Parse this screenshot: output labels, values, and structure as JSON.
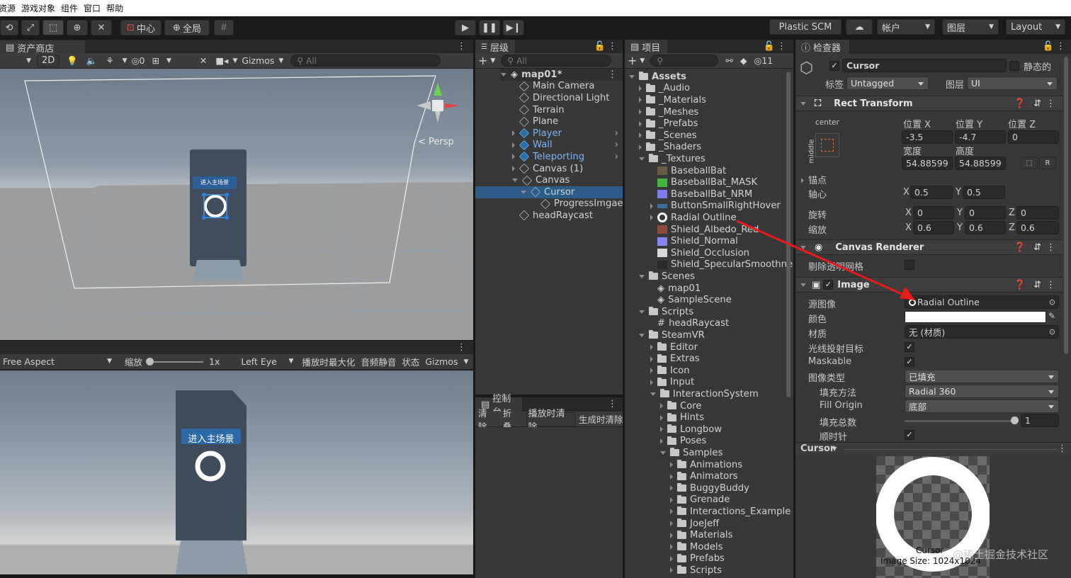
{
  "menubar": {
    "items": [
      "资源",
      "游戏对象",
      "组件",
      "窗口",
      "帮助"
    ]
  },
  "toolbar": {
    "pivot": "中心",
    "space": "全局",
    "plastic": "Plastic SCM",
    "account": "帐户",
    "layers": "图层",
    "layout": "Layout"
  },
  "scene": {
    "tab": "资产商店",
    "mode2d": "2D",
    "hidden_count": "0",
    "gizmos": "Gizmos",
    "search_placeholder": "All",
    "persp": "< Persp",
    "button_text": "进入主场景"
  },
  "game": {
    "aspect": "Free Aspect",
    "scale_label": "缩放",
    "scale_value": "1x",
    "eye": "Left Eye",
    "maximize": "播放时最大化",
    "mute": "音频静音",
    "stats": "状态",
    "gizmos": "Gizmos",
    "button_text": "进入主场景"
  },
  "hierarchy": {
    "tab": "层级",
    "search_placeholder": "All",
    "scene": "map01*",
    "items": [
      {
        "label": "Main Camera",
        "blue": false
      },
      {
        "label": "Directional Light",
        "blue": false
      },
      {
        "label": "Terrain",
        "blue": false
      },
      {
        "label": "Plane",
        "blue": false
      },
      {
        "label": "Player",
        "blue": true
      },
      {
        "label": "Wall",
        "blue": true
      },
      {
        "label": "Teleporting",
        "blue": true
      },
      {
        "label": "Canvas (1)",
        "blue": false
      },
      {
        "label": "Canvas",
        "blue": false
      },
      {
        "label": "Cursor",
        "blue": false
      },
      {
        "label": "ProgressImgae",
        "blue": false
      },
      {
        "label": "headRaycast",
        "blue": false
      }
    ]
  },
  "console": {
    "tab": "控制台",
    "buttons": [
      "清除",
      "折叠",
      "播放时清除",
      "生成时清除"
    ]
  },
  "project": {
    "tab": "项目",
    "hidden_count": "11",
    "items": [
      "Assets",
      "_Audio",
      "_Materials",
      "_Meshes",
      "_Prefabs",
      "_Scenes",
      "_Shaders",
      "_Textures",
      "BaseballBat",
      "BaseballBat_MASK",
      "BaseballBat_NRM",
      "ButtonSmallRightHover",
      "Radial Outline",
      "Shield_Albedo_Red",
      "Shield_Normal",
      "Shield_Occlusion",
      "Shield_SpecularSmoothness",
      "Scenes",
      "map01",
      "SampleScene",
      "Scripts",
      "headRaycast",
      "SteamVR",
      "Editor",
      "Extras",
      "Icon",
      "Input",
      "InteractionSystem",
      "Core",
      "Hints",
      "Longbow",
      "Poses",
      "Samples",
      "Animations",
      "Animators",
      "BuggyBuddy",
      "Grenade",
      "Interactions_Example",
      "JoeJeff",
      "Materials",
      "Models",
      "Prefabs",
      "Scripts"
    ]
  },
  "inspector": {
    "tab": "检查器",
    "object_name": "Cursor",
    "static_label": "静态的",
    "tag_label": "标签",
    "tag_value": "Untagged",
    "layer_label": "图层",
    "layer_value": "UI",
    "rect": {
      "title": "Rect Transform",
      "anchor_h": "center",
      "anchor_v": "middle",
      "pos_x_label": "位置 X",
      "pos_y_label": "位置 Y",
      "pos_z_label": "位置 Z",
      "pos_x": "-3.5",
      "pos_y": "-4.7",
      "pos_z": "0",
      "width_label": "宽度",
      "height_label": "高度",
      "width": "54.88599",
      "height": "54.88599",
      "anchors_label": "锚点",
      "pivot_label": "轴心",
      "pivot_x": "0.5",
      "pivot_y": "0.5",
      "rotation_label": "旋转",
      "rot_x": "0",
      "rot_y": "0",
      "rot_z": "0",
      "scale_label": "缩放",
      "scale_x": "0.6",
      "scale_y": "0.6",
      "scale_z": "0.6"
    },
    "canvas_renderer": {
      "title": "Canvas Renderer",
      "cull_label": "剔除透明网格"
    },
    "image": {
      "title": "Image",
      "source_label": "源图像",
      "source_value": "Radial Outline",
      "color_label": "颜色",
      "material_label": "材质",
      "material_value": "无 (材质)",
      "raycast_label": "光线投射目标",
      "maskable_label": "Maskable",
      "type_label": "图像类型",
      "type_value": "已填充",
      "fill_method_label": "填充方法",
      "fill_method_value": "Radial 360",
      "fill_origin_label": "Fill Origin",
      "fill_origin_value": "底部",
      "fill_amount_label": "填充总数",
      "fill_amount_value": "1",
      "clockwise_label": "顺时针"
    },
    "preview": {
      "title": "Cursor",
      "caption1": "Cursor",
      "caption2": "Image Size: 1024x1024",
      "watermark": "@稀土掘金技术社区"
    }
  },
  "colors": {
    "selection": "#2c5d87",
    "prefab_blue": "#7cb4f6",
    "annotation_red": "#e81b1b"
  }
}
